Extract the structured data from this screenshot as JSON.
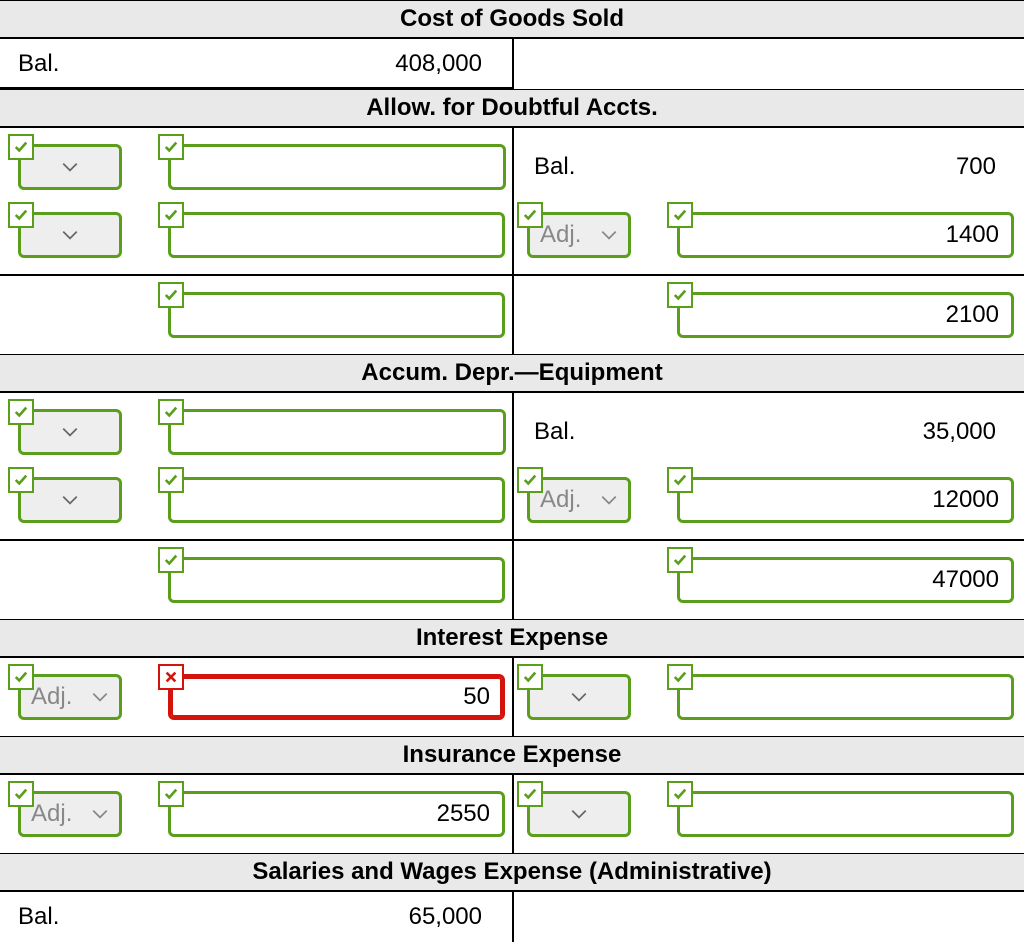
{
  "accounts": {
    "cogs": {
      "title": "Cost of Goods Sold",
      "bal_label": "Bal.",
      "bal_value": "408,000"
    },
    "ada": {
      "title": "Allow. for Doubtful Accts.",
      "bal_label": "Bal.",
      "bal_value": "700",
      "adj_label": "Adj.",
      "adj_value": "1400",
      "total_value": "2100"
    },
    "accum": {
      "title": "Accum. Depr.—Equipment",
      "bal_label": "Bal.",
      "bal_value": "35,000",
      "adj_label": "Adj.",
      "adj_value": "12000",
      "total_value": "47000"
    },
    "interest": {
      "title": "Interest Expense",
      "adj_label": "Adj.",
      "adj_value": "50"
    },
    "insurance": {
      "title": "Insurance Expense",
      "adj_label": "Adj.",
      "adj_value": "2550"
    },
    "salaries": {
      "title": "Salaries and Wages Expense (Administrative)",
      "bal_label": "Bal.",
      "bal_value": "65,000"
    }
  }
}
